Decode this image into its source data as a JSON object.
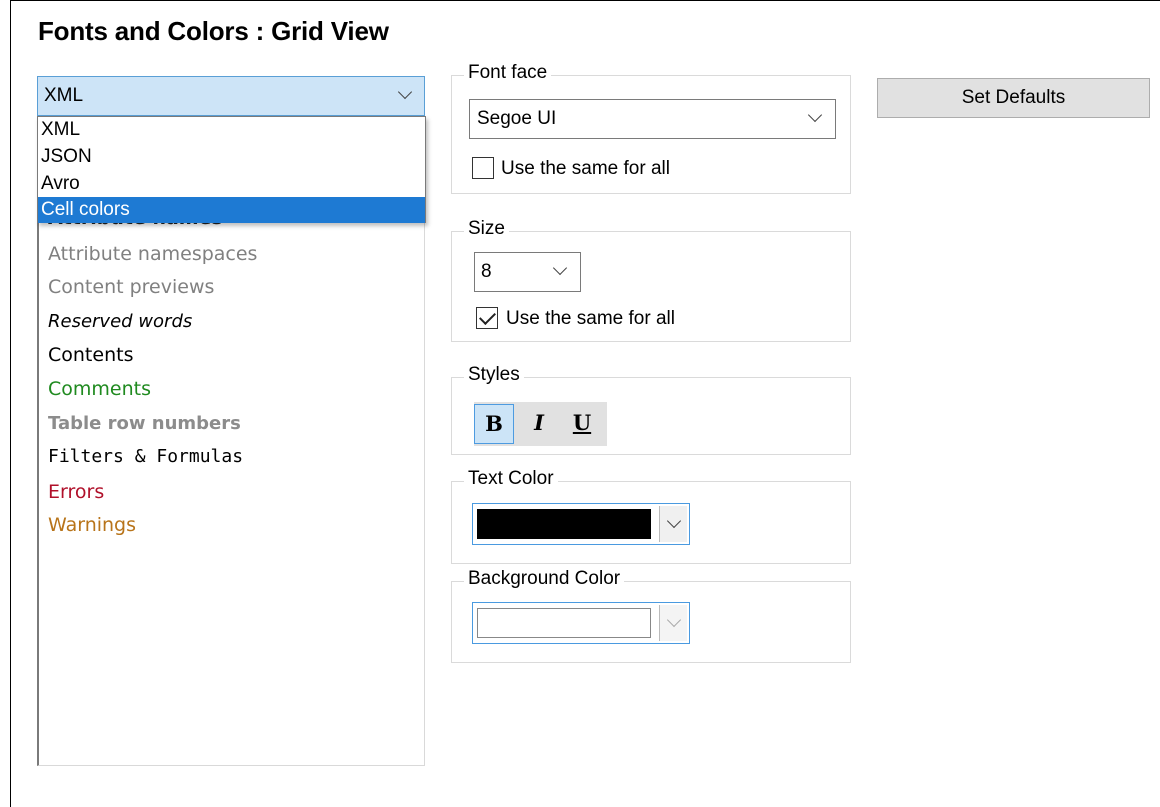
{
  "dialog": {
    "title": "Fonts and Colors : Grid View"
  },
  "category_select": {
    "value": "XML",
    "options": [
      "XML",
      "JSON",
      "Avro",
      "Cell colors"
    ],
    "highlighted": "Cell colors"
  },
  "element_list": {
    "items": [
      {
        "label": "Attribute names",
        "color": "#222222"
      },
      {
        "label": "Attribute namespaces",
        "color": "#808080"
      },
      {
        "label": "Content previews",
        "color": "#808080"
      },
      {
        "label": "Reserved words",
        "color": "#000000"
      },
      {
        "label": "Contents",
        "color": "#000000"
      },
      {
        "label": "Comments",
        "color": "#1f8a1f"
      },
      {
        "label": "Table row numbers",
        "color": "#8c8c8c"
      },
      {
        "label": "Filters & Formulas",
        "color": "#000000"
      },
      {
        "label": "Errors",
        "color": "#b0102a"
      },
      {
        "label": "Warnings",
        "color": "#b8741a"
      }
    ]
  },
  "font_face": {
    "group_label": "Font face",
    "value": "Segoe UI",
    "same_for_all_label": "Use the same for all",
    "same_for_all_checked": false
  },
  "size": {
    "group_label": "Size",
    "value": "8",
    "same_for_all_label": "Use the same for all",
    "same_for_all_checked": true
  },
  "styles": {
    "group_label": "Styles",
    "bold": "B",
    "italic": "I",
    "underline": "U",
    "bold_active": true
  },
  "text_color": {
    "group_label": "Text Color",
    "swatch": "#000000"
  },
  "background_color": {
    "group_label": "Background Color",
    "swatch": "#ffffff"
  },
  "set_defaults_label": "Set Defaults"
}
